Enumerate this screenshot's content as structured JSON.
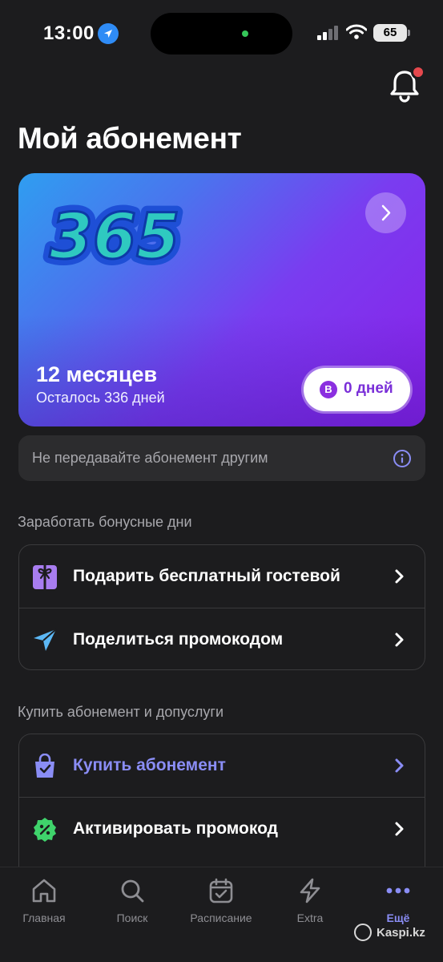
{
  "status_bar": {
    "time": "13:00",
    "battery": "65",
    "icons": [
      "location-arrow-icon",
      "cellular-signal-icon",
      "wifi-icon",
      "battery-icon"
    ]
  },
  "header": {
    "title": "Мой абонемент",
    "notification_icon": "bell-icon",
    "has_unread": true
  },
  "subscription_card": {
    "logo_text": "365",
    "duration": "12 месяцев",
    "remaining": "Осталось 336 дней",
    "bonus_badge": "B",
    "bonus_days": "0 дней",
    "colors": {
      "gradient_start": "#2f9ef0",
      "gradient_end": "#8a20e8"
    }
  },
  "notice": {
    "text": "Не передавайте абонемент другим",
    "icon": "info-icon"
  },
  "sections": [
    {
      "title": "Заработать бонусные дни",
      "items": [
        {
          "label": "Подарить бесплатный гостевой",
          "icon": "gift-icon"
        },
        {
          "label": "Поделиться промокодом",
          "icon": "paper-plane-icon"
        }
      ]
    },
    {
      "title": "Купить абонемент и допуслуги",
      "items": [
        {
          "label": "Купить абонемент",
          "icon": "shopping-bag-icon"
        },
        {
          "label": "Активировать промокод",
          "icon": "percent-badge-icon"
        }
      ]
    }
  ],
  "tab_bar": {
    "tabs": [
      {
        "label": "Главная",
        "icon": "home-icon"
      },
      {
        "label": "Поиск",
        "icon": "search-icon"
      },
      {
        "label": "Расписание",
        "icon": "calendar-check-icon"
      },
      {
        "label": "Extra",
        "icon": "lightning-icon"
      },
      {
        "label": "Ещё",
        "icon": "more-dots-icon"
      }
    ],
    "active": "Ещё"
  },
  "watermark": "Kaspi.kz",
  "colors": {
    "background": "#1c1c1e",
    "surface": "#2c2c2e",
    "accent": "#8a8df5",
    "notification": "#e5484d"
  }
}
